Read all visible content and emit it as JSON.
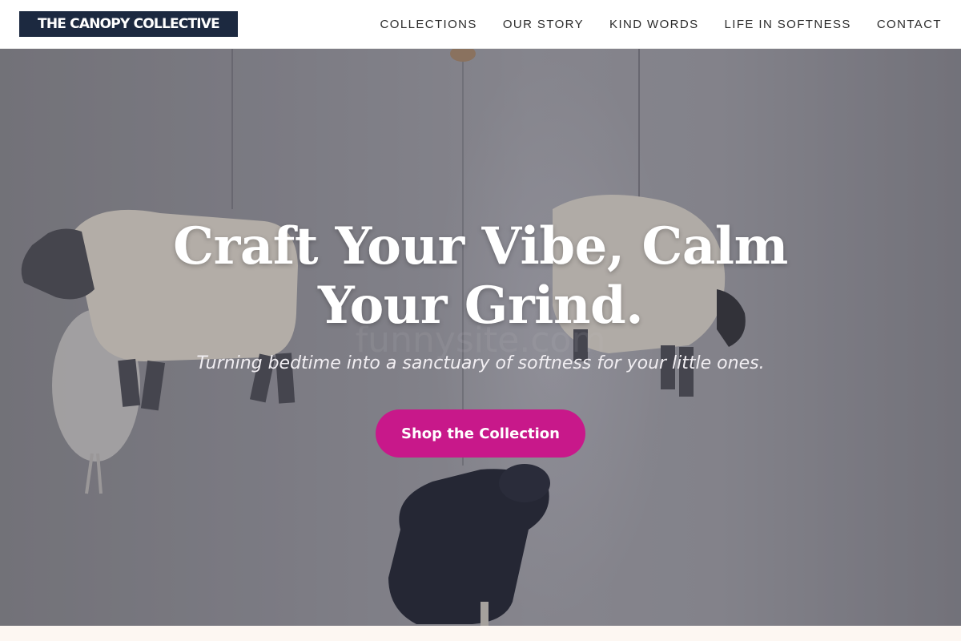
{
  "brand": {
    "name": "THE CANOPY COLLECTIVE"
  },
  "nav": {
    "items": [
      {
        "label": "COLLECTIONS"
      },
      {
        "label": "OUR STORY"
      },
      {
        "label": "KIND WORDS"
      },
      {
        "label": "LIFE IN SOFTNESS"
      },
      {
        "label": "CONTACT"
      }
    ]
  },
  "hero": {
    "headline": "Craft Your Vibe, Calm Your Grind.",
    "subheadline": "Turning bedtime into a sanctuary of softness for your little ones.",
    "cta_label": "Shop the Collection",
    "background_image": "felt-sheep-mobile-photo"
  },
  "colors": {
    "logo_bg": "#1c2940",
    "cta_bg": "#c8188a",
    "nav_text": "#2c2c2c",
    "page_bg": "#fdf7f2"
  }
}
